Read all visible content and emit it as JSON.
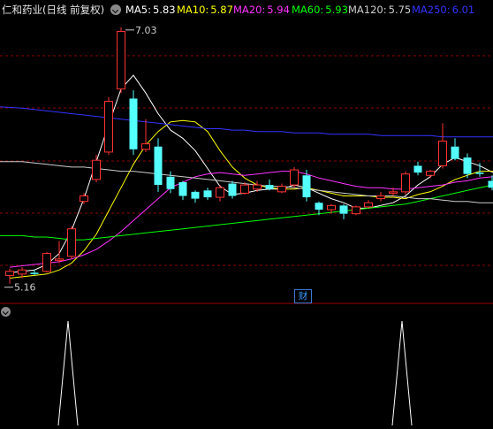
{
  "stock": {
    "title": "仁和药业(日线 前复权)"
  },
  "moving_averages": [
    {
      "label": "MA5:",
      "value": "5.83",
      "color": "#ffffff"
    },
    {
      "label": "MA10:",
      "value": "5.87",
      "color": "#ffff00"
    },
    {
      "label": "MA20:",
      "value": "5.94",
      "color": "#ff33ff"
    },
    {
      "label": "MA60:",
      "value": "5.93",
      "color": "#00ff00"
    },
    {
      "label": "MA120:",
      "value": "5.75",
      "color": "#cccccc"
    },
    {
      "label": "MA250:",
      "value": "6.01",
      "color": "#3333ff"
    }
  ],
  "annotations": {
    "high": "7.03",
    "low": "5.16"
  },
  "badge": {
    "label": "财"
  },
  "colors": {
    "up": "#ff3333",
    "down": "#54ffff",
    "grid": "#8b0000",
    "background": "#000000"
  },
  "chart_data": {
    "type": "candlestick",
    "price_range": [
      5.1,
      7.1
    ],
    "candles": [
      {
        "o": 5.22,
        "h": 5.27,
        "l": 5.16,
        "c": 5.25
      },
      {
        "o": 5.23,
        "h": 5.28,
        "l": 5.2,
        "c": 5.26
      },
      {
        "o": 5.24,
        "h": 5.26,
        "l": 5.22,
        "c": 5.23
      },
      {
        "o": 5.25,
        "h": 5.39,
        "l": 5.24,
        "c": 5.38
      },
      {
        "o": 5.33,
        "h": 5.47,
        "l": 5.31,
        "c": 5.34
      },
      {
        "o": 5.36,
        "h": 5.58,
        "l": 5.34,
        "c": 5.56
      },
      {
        "o": 5.76,
        "h": 5.82,
        "l": 5.74,
        "c": 5.8
      },
      {
        "o": 5.92,
        "h": 6.1,
        "l": 5.9,
        "c": 6.06
      },
      {
        "o": 6.12,
        "h": 6.52,
        "l": 6.1,
        "c": 6.49
      },
      {
        "o": 6.58,
        "h": 7.03,
        "l": 6.55,
        "c": 7.0
      },
      {
        "o": 6.51,
        "h": 6.57,
        "l": 6.1,
        "c": 6.14
      },
      {
        "o": 6.14,
        "h": 6.36,
        "l": 6.12,
        "c": 6.18
      },
      {
        "o": 6.16,
        "h": 6.22,
        "l": 5.83,
        "c": 5.88
      },
      {
        "o": 5.94,
        "h": 5.98,
        "l": 5.82,
        "c": 5.85
      },
      {
        "o": 5.9,
        "h": 5.91,
        "l": 5.77,
        "c": 5.8
      },
      {
        "o": 5.83,
        "h": 5.84,
        "l": 5.75,
        "c": 5.78
      },
      {
        "o": 5.84,
        "h": 5.86,
        "l": 5.77,
        "c": 5.79
      },
      {
        "o": 5.79,
        "h": 5.88,
        "l": 5.76,
        "c": 5.86
      },
      {
        "o": 5.89,
        "h": 5.91,
        "l": 5.78,
        "c": 5.8
      },
      {
        "o": 5.82,
        "h": 5.9,
        "l": 5.81,
        "c": 5.88
      },
      {
        "o": 5.85,
        "h": 5.91,
        "l": 5.83,
        "c": 5.88
      },
      {
        "o": 5.88,
        "h": 5.92,
        "l": 5.84,
        "c": 5.85
      },
      {
        "o": 5.83,
        "h": 5.89,
        "l": 5.82,
        "c": 5.87
      },
      {
        "o": 5.88,
        "h": 6.01,
        "l": 5.86,
        "c": 5.99
      },
      {
        "o": 5.95,
        "h": 5.99,
        "l": 5.76,
        "c": 5.79
      },
      {
        "o": 5.75,
        "h": 5.76,
        "l": 5.66,
        "c": 5.7
      },
      {
        "o": 5.7,
        "h": 5.74,
        "l": 5.67,
        "c": 5.73
      },
      {
        "o": 5.73,
        "h": 5.74,
        "l": 5.63,
        "c": 5.67
      },
      {
        "o": 5.67,
        "h": 5.73,
        "l": 5.66,
        "c": 5.72
      },
      {
        "o": 5.72,
        "h": 5.77,
        "l": 5.71,
        "c": 5.75
      },
      {
        "o": 5.78,
        "h": 5.83,
        "l": 5.76,
        "c": 5.8
      },
      {
        "o": 5.82,
        "h": 5.86,
        "l": 5.8,
        "c": 5.83
      },
      {
        "o": 5.83,
        "h": 5.98,
        "l": 5.81,
        "c": 5.96
      },
      {
        "o": 6.02,
        "h": 6.05,
        "l": 5.95,
        "c": 5.97
      },
      {
        "o": 5.95,
        "h": 5.99,
        "l": 5.93,
        "c": 5.98
      },
      {
        "o": 6.02,
        "h": 6.33,
        "l": 6.0,
        "c": 6.2
      },
      {
        "o": 6.16,
        "h": 6.22,
        "l": 6.06,
        "c": 6.07
      },
      {
        "o": 6.08,
        "h": 6.11,
        "l": 5.93,
        "c": 5.96
      },
      {
        "o": 5.97,
        "h": 6.04,
        "l": 5.94,
        "c": 5.96
      },
      {
        "o": 5.91,
        "h": 5.95,
        "l": 5.84,
        "c": 5.86
      }
    ],
    "ma_series": {
      "MA5": [
        5.24,
        5.25,
        5.26,
        5.3,
        5.38,
        5.55,
        5.78,
        6.05,
        6.32,
        6.58,
        6.68,
        6.55,
        6.4,
        6.28,
        6.22,
        6.13,
        6.0,
        5.87,
        5.81,
        5.82,
        5.84,
        5.85,
        5.85,
        5.88,
        5.86,
        5.82,
        5.78,
        5.75,
        5.71,
        5.71,
        5.73,
        5.75,
        5.8,
        5.88,
        5.94,
        6.03,
        6.08,
        6.05,
        6.02,
        5.97
      ],
      "MA10": [
        5.2,
        5.21,
        5.22,
        5.23,
        5.26,
        5.31,
        5.4,
        5.52,
        5.69,
        5.86,
        6.03,
        6.17,
        6.27,
        6.34,
        6.35,
        6.34,
        6.27,
        6.13,
        6.01,
        5.93,
        5.88,
        5.86,
        5.85,
        5.85,
        5.86,
        5.84,
        5.82,
        5.8,
        5.8,
        5.8,
        5.79,
        5.79,
        5.78,
        5.81,
        5.83,
        5.87,
        5.92,
        5.95,
        5.98,
        5.98
      ],
      "MA20": [
        5.28,
        5.29,
        5.3,
        5.31,
        5.32,
        5.34,
        5.37,
        5.41,
        5.47,
        5.54,
        5.62,
        5.7,
        5.78,
        5.86,
        5.9,
        5.94,
        5.96,
        5.97,
        5.96,
        5.95,
        5.96,
        5.97,
        5.98,
        5.98,
        5.96,
        5.93,
        5.91,
        5.89,
        5.87,
        5.86,
        5.86,
        5.85,
        5.85,
        5.86,
        5.87,
        5.88,
        5.9,
        5.91,
        5.93,
        5.94
      ],
      "MA60": [
        5.51,
        5.51,
        5.5,
        5.5,
        5.49,
        5.48,
        5.48,
        5.49,
        5.5,
        5.51,
        5.52,
        5.53,
        5.54,
        5.55,
        5.56,
        5.57,
        5.58,
        5.59,
        5.6,
        5.61,
        5.62,
        5.63,
        5.64,
        5.65,
        5.66,
        5.67,
        5.68,
        5.69,
        5.7,
        5.71,
        5.72,
        5.73,
        5.74,
        5.76,
        5.78,
        5.8,
        5.82,
        5.84,
        5.86,
        5.88
      ],
      "MA120": [
        6.05,
        6.05,
        6.04,
        6.03,
        6.02,
        6.01,
        6.01,
        6.0,
        5.99,
        5.98,
        5.98,
        5.97,
        5.96,
        5.95,
        5.94,
        5.93,
        5.92,
        5.91,
        5.9,
        5.89,
        5.88,
        5.87,
        5.87,
        5.86,
        5.85,
        5.84,
        5.83,
        5.82,
        5.81,
        5.8,
        5.8,
        5.8,
        5.79,
        5.78,
        5.78,
        5.77,
        5.76,
        5.76,
        5.75,
        5.75
      ],
      "MA250": [
        6.45,
        6.44,
        6.43,
        6.42,
        6.41,
        6.4,
        6.39,
        6.38,
        6.37,
        6.36,
        6.35,
        6.34,
        6.33,
        6.32,
        6.31,
        6.3,
        6.29,
        6.29,
        6.28,
        6.28,
        6.27,
        6.27,
        6.27,
        6.26,
        6.26,
        6.26,
        6.25,
        6.25,
        6.25,
        6.25,
        6.24,
        6.24,
        6.24,
        6.24,
        6.24,
        6.23,
        6.23,
        6.23,
        6.23,
        6.23
      ]
    },
    "signal_spikes_at": [
      4,
      31
    ]
  }
}
